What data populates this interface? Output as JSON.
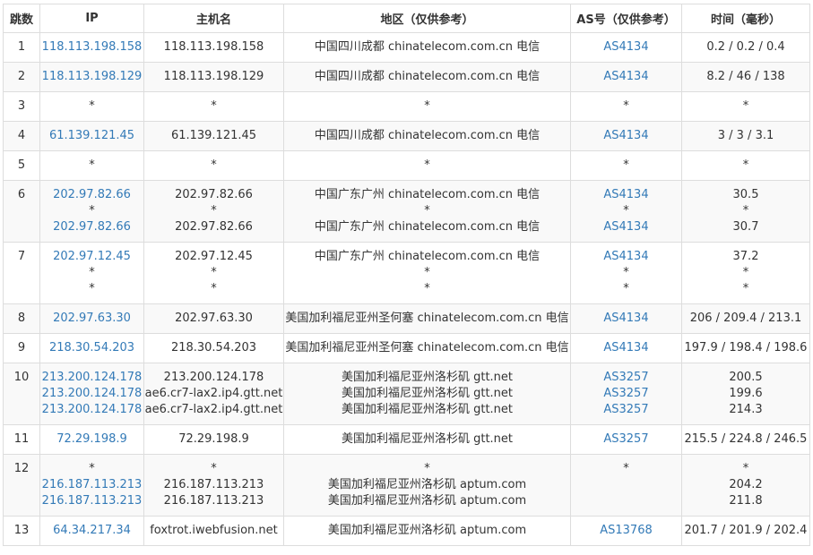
{
  "headers": {
    "hop": "跳数",
    "ip": "IP",
    "host": "主机名",
    "region": "地区（仅供参考）",
    "asn": "AS号（仅供参考）",
    "time": "时间（毫秒）"
  },
  "colors": {
    "link": "#337ab7",
    "text": "#333333",
    "border": "#dddddd",
    "stripe": "#f9f9f9"
  },
  "rows": [
    {
      "hop": "1",
      "ip": [
        "118.113.198.158"
      ],
      "host": [
        "118.113.198.158"
      ],
      "region": [
        "中国四川成都 chinatelecom.com.cn 电信"
      ],
      "asn": [
        "AS4134"
      ],
      "time": [
        "0.2 / 0.2 / 0.4"
      ]
    },
    {
      "hop": "2",
      "ip": [
        "118.113.198.129"
      ],
      "host": [
        "118.113.198.129"
      ],
      "region": [
        "中国四川成都 chinatelecom.com.cn 电信"
      ],
      "asn": [
        "AS4134"
      ],
      "time": [
        "8.2 / 46 / 138"
      ]
    },
    {
      "hop": "3",
      "ip": [
        "*"
      ],
      "host": [
        "*"
      ],
      "region": [
        "*"
      ],
      "asn": [
        "*"
      ],
      "time": [
        "*"
      ]
    },
    {
      "hop": "4",
      "ip": [
        "61.139.121.45"
      ],
      "host": [
        "61.139.121.45"
      ],
      "region": [
        "中国四川成都 chinatelecom.com.cn 电信"
      ],
      "asn": [
        "AS4134"
      ],
      "time": [
        "3 / 3 / 3.1"
      ]
    },
    {
      "hop": "5",
      "ip": [
        "*"
      ],
      "host": [
        "*"
      ],
      "region": [
        "*"
      ],
      "asn": [
        "*"
      ],
      "time": [
        "*"
      ]
    },
    {
      "hop": "6",
      "ip": [
        "202.97.82.66",
        "*",
        "202.97.82.66"
      ],
      "host": [
        "202.97.82.66",
        "*",
        "202.97.82.66"
      ],
      "region": [
        "中国广东广州 chinatelecom.com.cn 电信",
        "*",
        "中国广东广州 chinatelecom.com.cn 电信"
      ],
      "asn": [
        "AS4134",
        "*",
        "AS4134"
      ],
      "time": [
        "30.5",
        "*",
        "30.7"
      ]
    },
    {
      "hop": "7",
      "ip": [
        "202.97.12.45",
        "*",
        "*"
      ],
      "host": [
        "202.97.12.45",
        "*",
        "*"
      ],
      "region": [
        "中国广东广州 chinatelecom.com.cn 电信",
        "*",
        "*"
      ],
      "asn": [
        "AS4134",
        "*",
        "*"
      ],
      "time": [
        "37.2",
        "*",
        "*"
      ]
    },
    {
      "hop": "8",
      "ip": [
        "202.97.63.30"
      ],
      "host": [
        "202.97.63.30"
      ],
      "region": [
        "美国加利福尼亚州圣何塞 chinatelecom.com.cn 电信"
      ],
      "asn": [
        "AS4134"
      ],
      "time": [
        "206 / 209.4 / 213.1"
      ]
    },
    {
      "hop": "9",
      "ip": [
        "218.30.54.203"
      ],
      "host": [
        "218.30.54.203"
      ],
      "region": [
        "美国加利福尼亚州圣何塞 chinatelecom.com.cn 电信"
      ],
      "asn": [
        "AS4134"
      ],
      "time": [
        "197.9 / 198.4 / 198.6"
      ]
    },
    {
      "hop": "10",
      "ip": [
        "213.200.124.178",
        "213.200.124.178",
        "213.200.124.178"
      ],
      "host": [
        "213.200.124.178",
        "ae6.cr7-lax2.ip4.gtt.net",
        "ae6.cr7-lax2.ip4.gtt.net"
      ],
      "region": [
        "美国加利福尼亚州洛杉矶 gtt.net",
        "美国加利福尼亚州洛杉矶 gtt.net",
        "美国加利福尼亚州洛杉矶 gtt.net"
      ],
      "asn": [
        "AS3257",
        "AS3257",
        "AS3257"
      ],
      "time": [
        "200.5",
        "199.6",
        "214.3"
      ]
    },
    {
      "hop": "11",
      "ip": [
        "72.29.198.9"
      ],
      "host": [
        "72.29.198.9"
      ],
      "region": [
        "美国加利福尼亚州洛杉矶 gtt.net"
      ],
      "asn": [
        "AS3257"
      ],
      "time": [
        "215.5 / 224.8 / 246.5"
      ]
    },
    {
      "hop": "12",
      "ip": [
        "*",
        "216.187.113.213",
        "216.187.113.213"
      ],
      "host": [
        "*",
        "216.187.113.213",
        "216.187.113.213"
      ],
      "region": [
        "*",
        "美国加利福尼亚州洛杉矶 aptum.com",
        "美国加利福尼亚州洛杉矶 aptum.com"
      ],
      "asn": [
        "*",
        "",
        ""
      ],
      "time": [
        "*",
        "204.2",
        "211.8"
      ]
    },
    {
      "hop": "13",
      "ip": [
        "64.34.217.34"
      ],
      "host": [
        "foxtrot.iwebfusion.net"
      ],
      "region": [
        "美国加利福尼亚州洛杉矶 aptum.com"
      ],
      "asn": [
        "AS13768"
      ],
      "time": [
        "201.7 / 201.9 / 202.4"
      ]
    }
  ]
}
